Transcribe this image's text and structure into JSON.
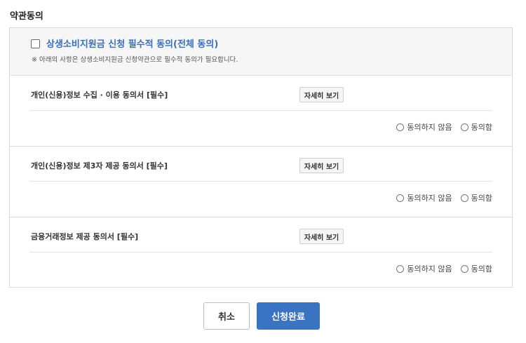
{
  "section_title": "약관동의",
  "all_agree": {
    "label": "상생소비지원금 신청 필수적 동의(전체 동의)",
    "note": "※ 아래의 사항은 상생소비지원금 신청약관으로 필수적 동의가 필요합니다.",
    "checked": false
  },
  "terms": [
    {
      "title": "개인(신용)정보 수집 · 이용 동의서 [필수]",
      "detail_label": "자세히 보기",
      "disagree_label": "동의하지 않음",
      "agree_label": "동의함"
    },
    {
      "title": "개인(신용)정보 제3자 제공 동의서 [필수]",
      "detail_label": "자세히 보기",
      "disagree_label": "동의하지 않음",
      "agree_label": "동의함"
    },
    {
      "title": "금융거래정보 제공 동의서 [필수]",
      "detail_label": "자세히 보기",
      "disagree_label": "동의하지 않음",
      "agree_label": "동의함"
    }
  ],
  "buttons": {
    "cancel_label": "취소",
    "submit_label": "신청완료"
  },
  "colors": {
    "accent": "#3a73c2",
    "all_agree_text": "#3a6fb5"
  }
}
